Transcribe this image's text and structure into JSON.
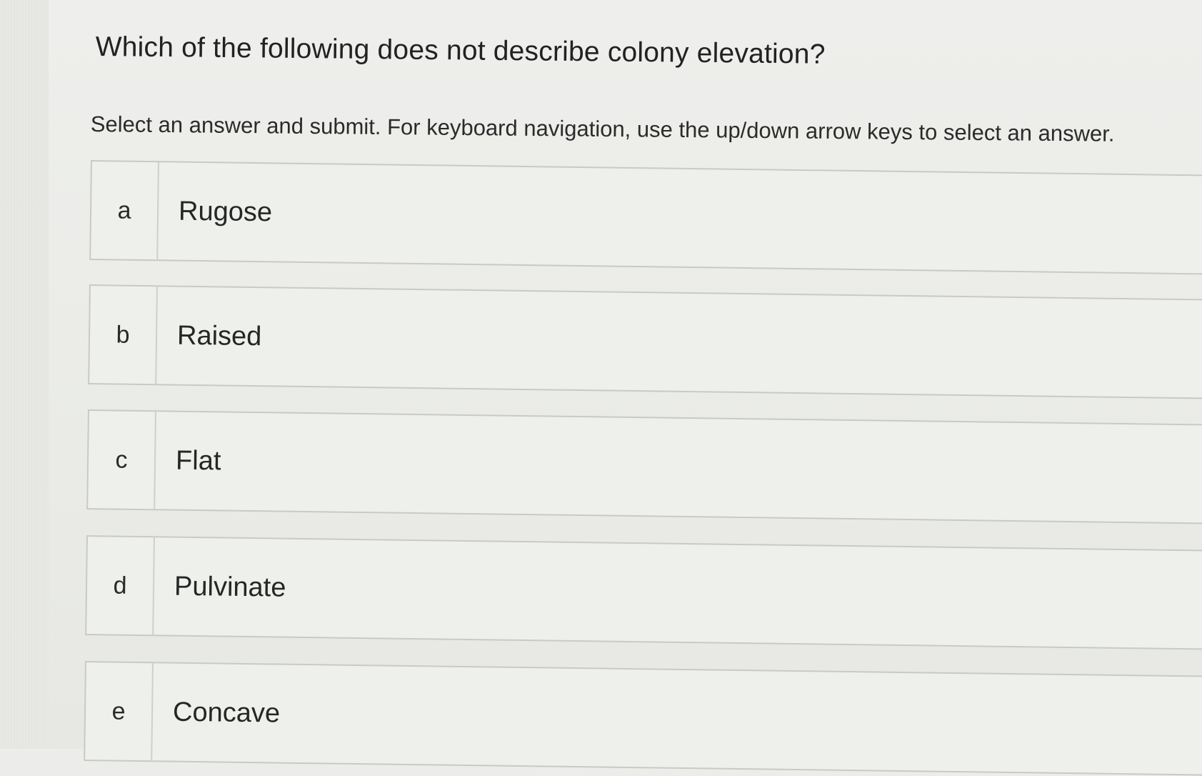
{
  "question": {
    "title": "Which of the following does not describe colony elevation?",
    "instructions": "Select an answer and submit. For keyboard navigation, use the up/down arrow keys to select an answer."
  },
  "options": [
    {
      "letter": "a",
      "text": "Rugose"
    },
    {
      "letter": "b",
      "text": "Raised"
    },
    {
      "letter": "c",
      "text": "Flat"
    },
    {
      "letter": "d",
      "text": "Pulvinate"
    },
    {
      "letter": "e",
      "text": "Concave"
    }
  ],
  "colors": {
    "background": "#ecedea",
    "border": "#c9cac6",
    "text": "#2a2a2a"
  }
}
